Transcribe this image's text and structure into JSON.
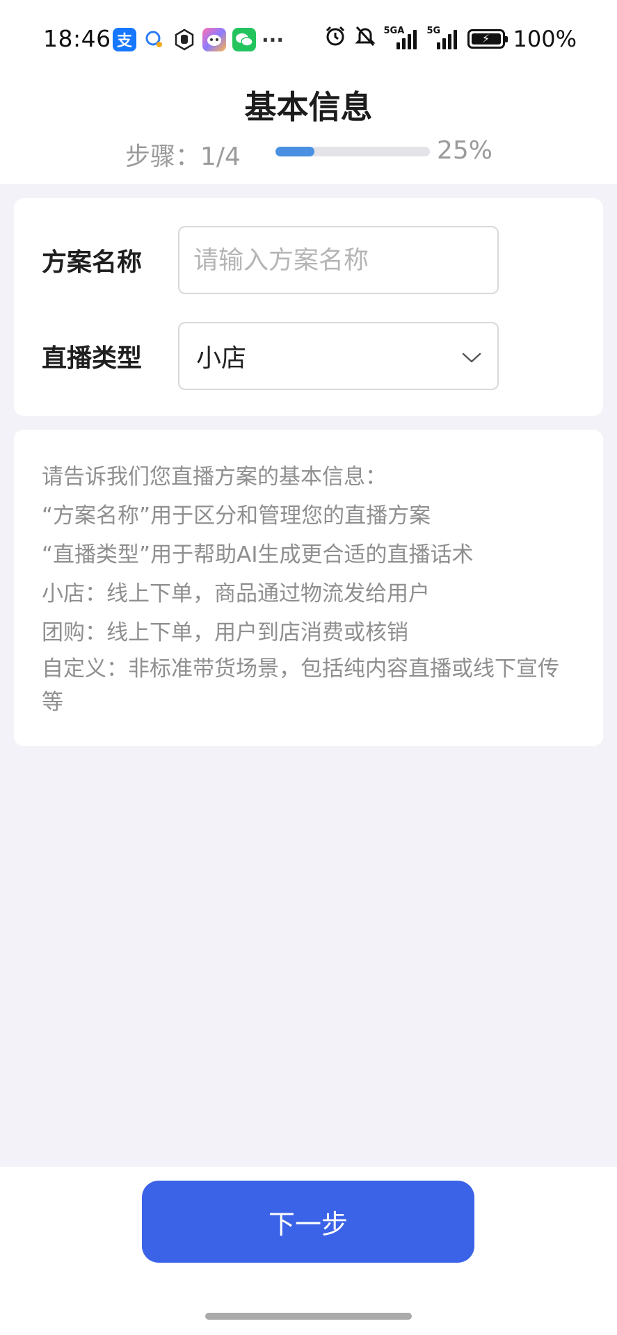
{
  "status_bar": {
    "time": "18:46",
    "app_icons": [
      "alipay-icon",
      "chat-bubble-icon",
      "hand-icon",
      "face-app-icon",
      "wechat-icon",
      "more-dots-icon"
    ],
    "alipay_glyph": "支",
    "more_glyph": "···",
    "network_1": "5GA",
    "network_2": "5G",
    "battery": "100%"
  },
  "header": {
    "title": "基本信息",
    "step_label": "步骤：1/4",
    "progress_fraction": 0.25,
    "percent_label": "25%",
    "progress_color": "#4a90e2"
  },
  "form": {
    "plan_name_label": "方案名称",
    "plan_name_placeholder": "请输入方案名称",
    "plan_name_value": "",
    "live_type_label": "直播类型",
    "live_type_value": "小店"
  },
  "info": {
    "lines": [
      "请告诉我们您直播方案的基本信息：",
      "“方案名称”用于区分和管理您的直播方案",
      "“直播类型”用于帮助AI生成更合适的直播话术",
      "小店：线上下单，商品通过物流发给用户",
      "团购：线上下单，用户到店消费或核销",
      "自定义：非标准带货场景，包括纯内容直播或线下宣传等"
    ]
  },
  "footer": {
    "next_label": "下一步",
    "button_color": "#3b63e8"
  }
}
